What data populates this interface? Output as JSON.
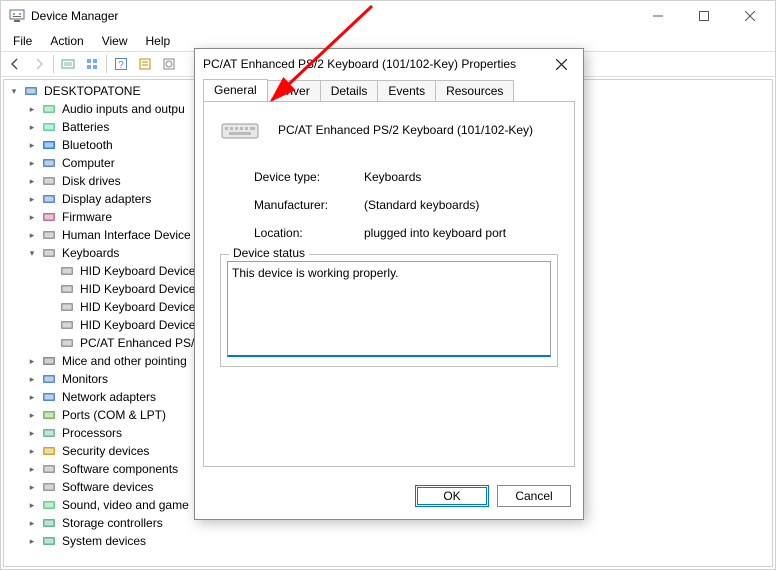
{
  "window": {
    "title": "Device Manager",
    "menu": [
      "File",
      "Action",
      "View",
      "Help"
    ]
  },
  "tree": {
    "root": "DESKTOPATONE",
    "nodes": [
      {
        "label": "Audio inputs and outpu",
        "icon": "audio"
      },
      {
        "label": "Batteries",
        "icon": "battery"
      },
      {
        "label": "Bluetooth",
        "icon": "bluetooth"
      },
      {
        "label": "Computer",
        "icon": "computer"
      },
      {
        "label": "Disk drives",
        "icon": "disk"
      },
      {
        "label": "Display adapters",
        "icon": "display"
      },
      {
        "label": "Firmware",
        "icon": "firmware"
      },
      {
        "label": "Human Interface Device",
        "icon": "hid"
      },
      {
        "label": "Keyboards",
        "icon": "keyboard",
        "expanded": true,
        "children": [
          {
            "label": "HID Keyboard Device",
            "icon": "keyboard"
          },
          {
            "label": "HID Keyboard Device",
            "icon": "keyboard"
          },
          {
            "label": "HID Keyboard Device",
            "icon": "keyboard"
          },
          {
            "label": "HID Keyboard Device",
            "icon": "keyboard"
          },
          {
            "label": "PC/AT Enhanced PS/",
            "icon": "keyboard"
          }
        ]
      },
      {
        "label": "Mice and other pointing",
        "icon": "mouse"
      },
      {
        "label": "Monitors",
        "icon": "monitor"
      },
      {
        "label": "Network adapters",
        "icon": "network"
      },
      {
        "label": "Ports (COM & LPT)",
        "icon": "port"
      },
      {
        "label": "Processors",
        "icon": "cpu"
      },
      {
        "label": "Security devices",
        "icon": "security"
      },
      {
        "label": "Software components",
        "icon": "softcomp"
      },
      {
        "label": "Software devices",
        "icon": "softdev"
      },
      {
        "label": "Sound, video and game",
        "icon": "sound"
      },
      {
        "label": "Storage controllers",
        "icon": "storage"
      },
      {
        "label": "System devices",
        "icon": "system"
      }
    ]
  },
  "dialog": {
    "title": "PC/AT Enhanced PS/2 Keyboard (101/102-Key) Properties",
    "tabs": [
      "General",
      "Driver",
      "Details",
      "Events",
      "Resources"
    ],
    "active_tab": "General",
    "device_name": "PC/AT Enhanced PS/2 Keyboard (101/102-Key)",
    "rows": {
      "type_label": "Device type:",
      "type_value": "Keyboards",
      "manu_label": "Manufacturer:",
      "manu_value": "(Standard keyboards)",
      "loc_label": "Location:",
      "loc_value": "plugged into keyboard port"
    },
    "status_legend": "Device status",
    "status_text": "This device is working properly.",
    "ok": "OK",
    "cancel": "Cancel"
  }
}
